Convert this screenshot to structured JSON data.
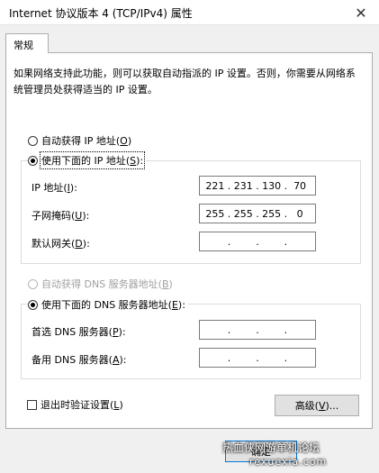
{
  "window": {
    "title": "Internet 协议版本 4 (TCP/IPv4) 属性",
    "close_glyph": "✕"
  },
  "tabs": [
    {
      "label": "常规"
    }
  ],
  "description": "如果网络支持此功能，则可以获取自动指派的 IP 设置。否则，你需要从网络系统管理员处获得适当的 IP 设置。",
  "ip_section": {
    "auto_radio": {
      "label_pre": "自动获得 IP 地址(",
      "key": "O",
      "label_post": ")",
      "checked": false
    },
    "manual_radio": {
      "label_pre": "使用下面的 IP 地址(",
      "key": "S",
      "label_post": "):",
      "checked": true
    },
    "fields": [
      {
        "label_pre": "IP 地址(",
        "key": "I",
        "label_post": "):",
        "octets": [
          "221",
          "231",
          "130",
          "70"
        ]
      },
      {
        "label_pre": "子网掩码(",
        "key": "U",
        "label_post": "):",
        "octets": [
          "255",
          "255",
          "255",
          "0"
        ]
      },
      {
        "label_pre": "默认网关(",
        "key": "D",
        "label_post": "):",
        "octets": [
          "",
          "",
          "",
          ""
        ]
      }
    ]
  },
  "dns_section": {
    "auto_radio": {
      "label_pre": "自动获得 DNS 服务器地址(",
      "key": "B",
      "label_post": ")",
      "checked": false,
      "disabled": true
    },
    "manual_radio": {
      "label_pre": "使用下面的 DNS 服务器地址(",
      "key": "E",
      "label_post": "):",
      "checked": true
    },
    "fields": [
      {
        "label_pre": "首选 DNS 服务器(",
        "key": "P",
        "label_post": "):",
        "octets": [
          "",
          "",
          "",
          ""
        ]
      },
      {
        "label_pre": "备用 DNS 服务器(",
        "key": "A",
        "label_post": "):",
        "octets": [
          "",
          "",
          "",
          ""
        ]
      }
    ]
  },
  "validate_checkbox": {
    "label_pre": "退出时验证设置(",
    "key": "L",
    "label_post": ")",
    "checked": false
  },
  "buttons": {
    "advanced": {
      "label_pre": "高级(",
      "key": "V",
      "label_post": ")..."
    },
    "ok": {
      "label": "确定"
    }
  },
  "watermark": {
    "line1": "热血侠网游单机论坛",
    "line2": "rexuexia.com"
  }
}
